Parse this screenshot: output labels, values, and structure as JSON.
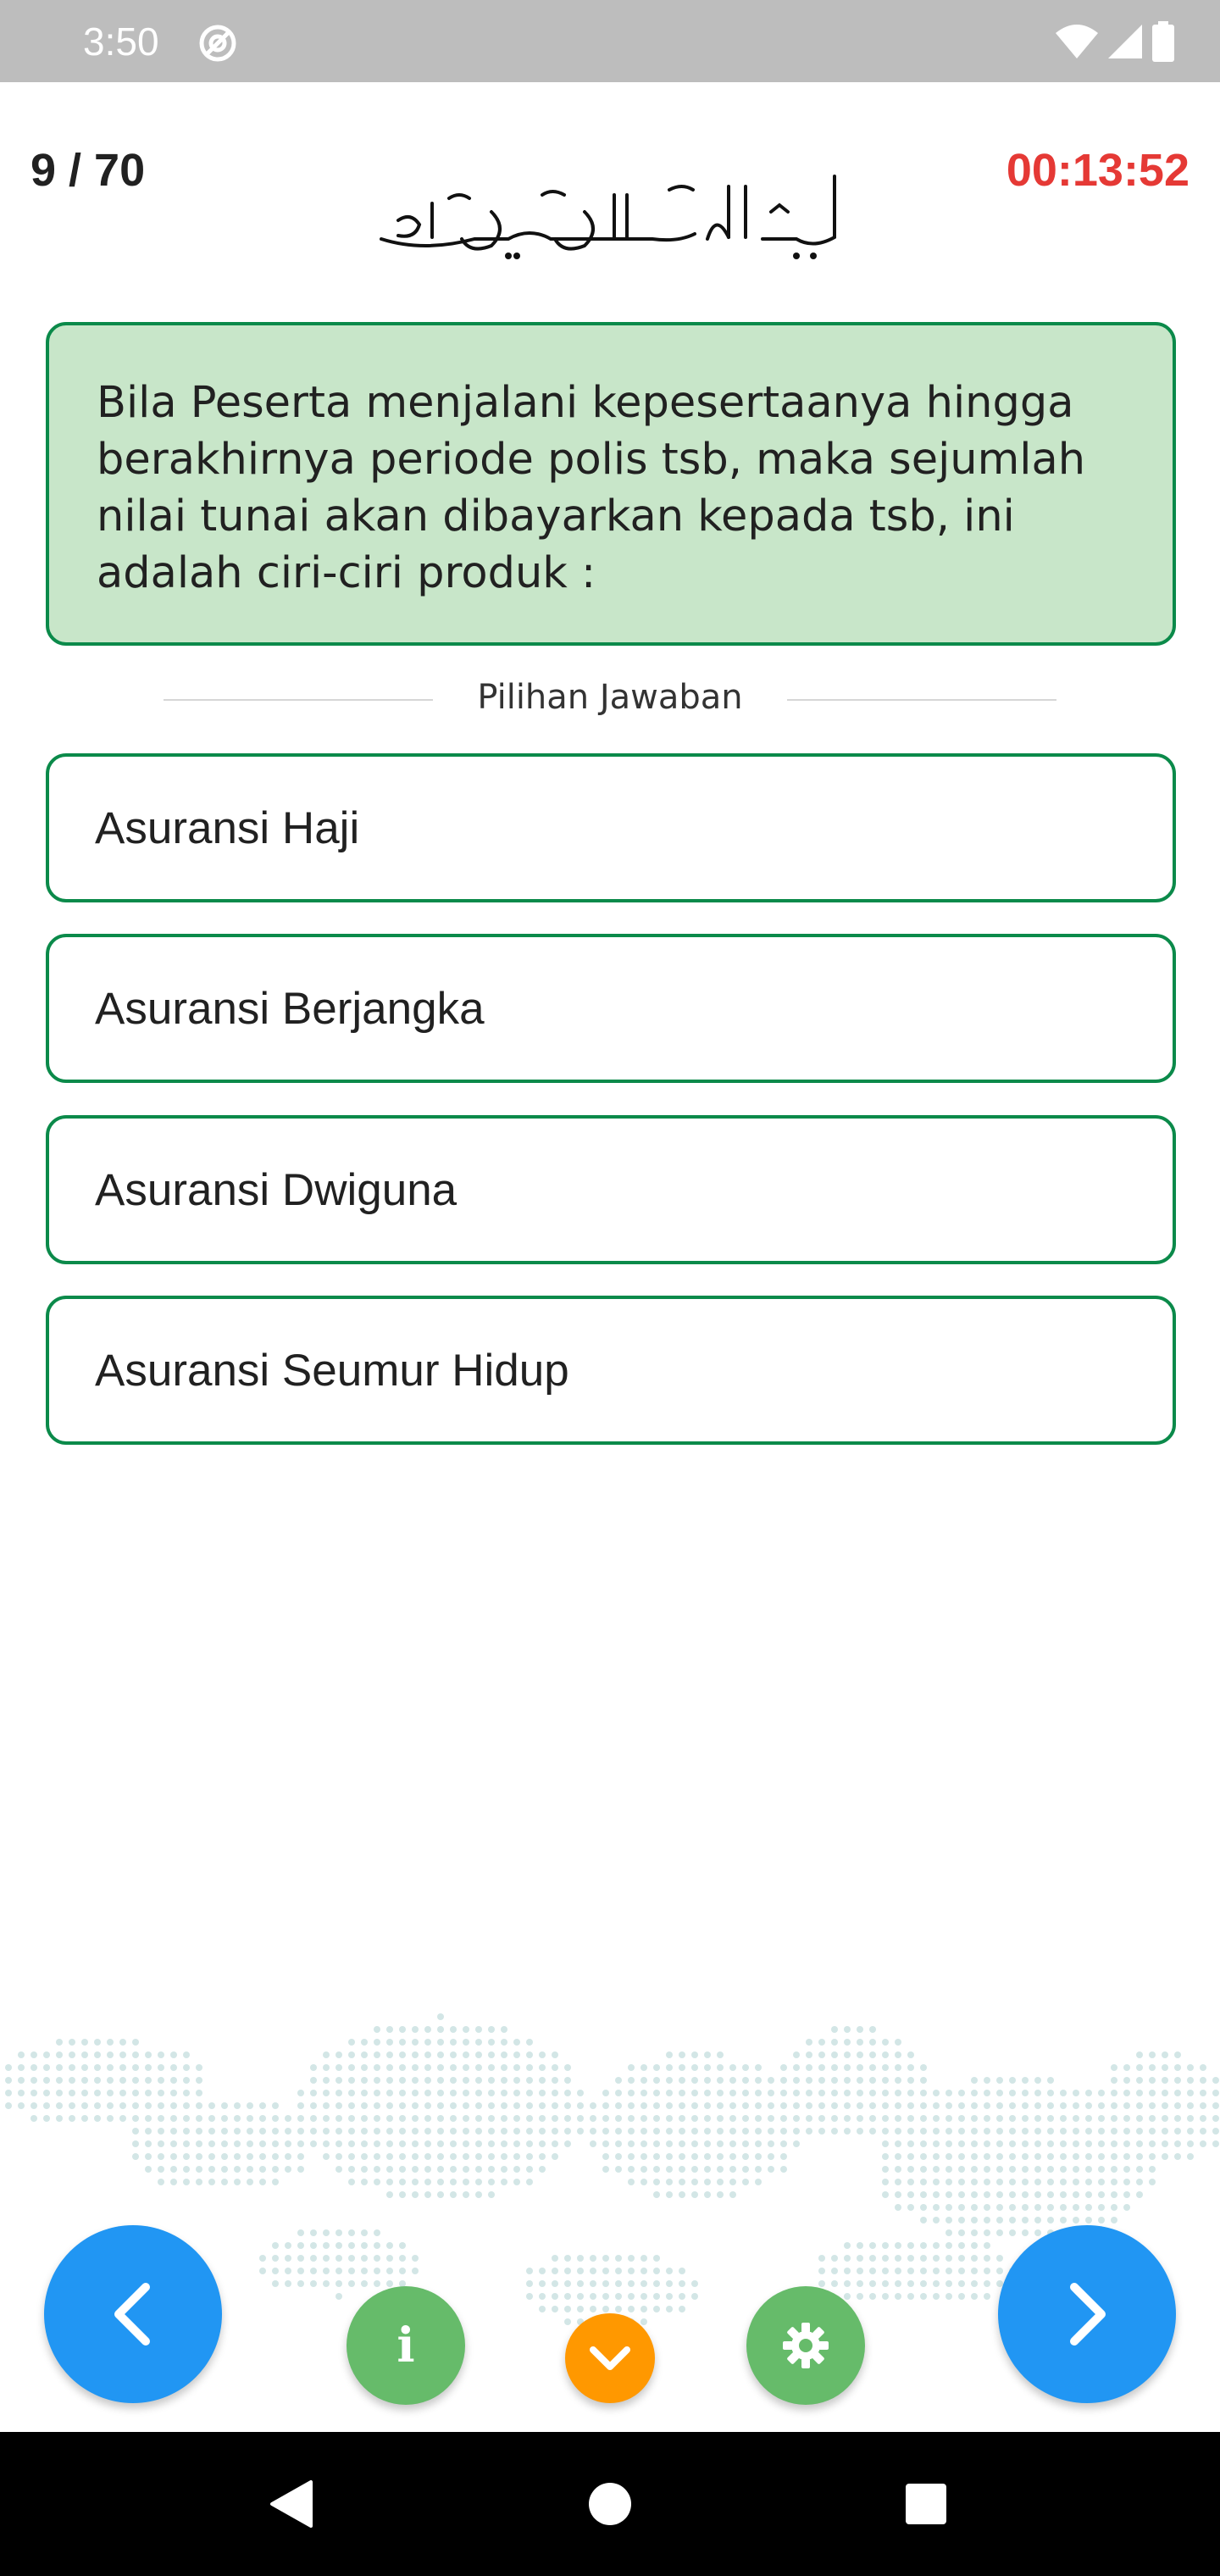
{
  "status_bar": {
    "time": "3:50",
    "icons": [
      "at-sign-icon",
      "wifi-icon",
      "signal-icon",
      "battery-icon"
    ]
  },
  "header": {
    "counter": "9 / 70",
    "timer": "00:13:52",
    "basmala_logo": "بِسْمِ اللَّهِ الرَّحْمَٰنِ الرَّحِيمِ"
  },
  "question": {
    "text": "Bila Peserta menjalani kepesertaanya hingga berakhirnya periode polis tsb, maka sejumlah nilai tunai akan dibayarkan kepada tsb, ini adalah ciri-ciri produk :"
  },
  "answers": {
    "label": "Pilihan Jawaban",
    "options": [
      "Asuransi Haji",
      "Asuransi Berjangka",
      "Asuransi Dwiguna",
      "Asuransi Seumur Hidup"
    ]
  },
  "controls": {
    "prev_icon": "chevron-left-icon",
    "info_icon": "info-icon",
    "collapse_icon": "chevron-down-icon",
    "settings_icon": "gear-icon",
    "next_icon": "chevron-right-icon"
  },
  "nav": {
    "icons": [
      "back-triangle-icon",
      "home-circle-icon",
      "recents-square-icon"
    ]
  },
  "colors": {
    "status_bar": "#bdbdbd",
    "timer": "#e53935",
    "card_fill": "#c8e6c9",
    "card_border": "#0b8a4a",
    "option_border": "#0b8a4a",
    "nav_fab": "#2196f3",
    "green_fab": "#66bb6a",
    "orange_fab": "#ff9800",
    "map_dots": "#d3e6e6",
    "nav_bar": "#000000"
  }
}
